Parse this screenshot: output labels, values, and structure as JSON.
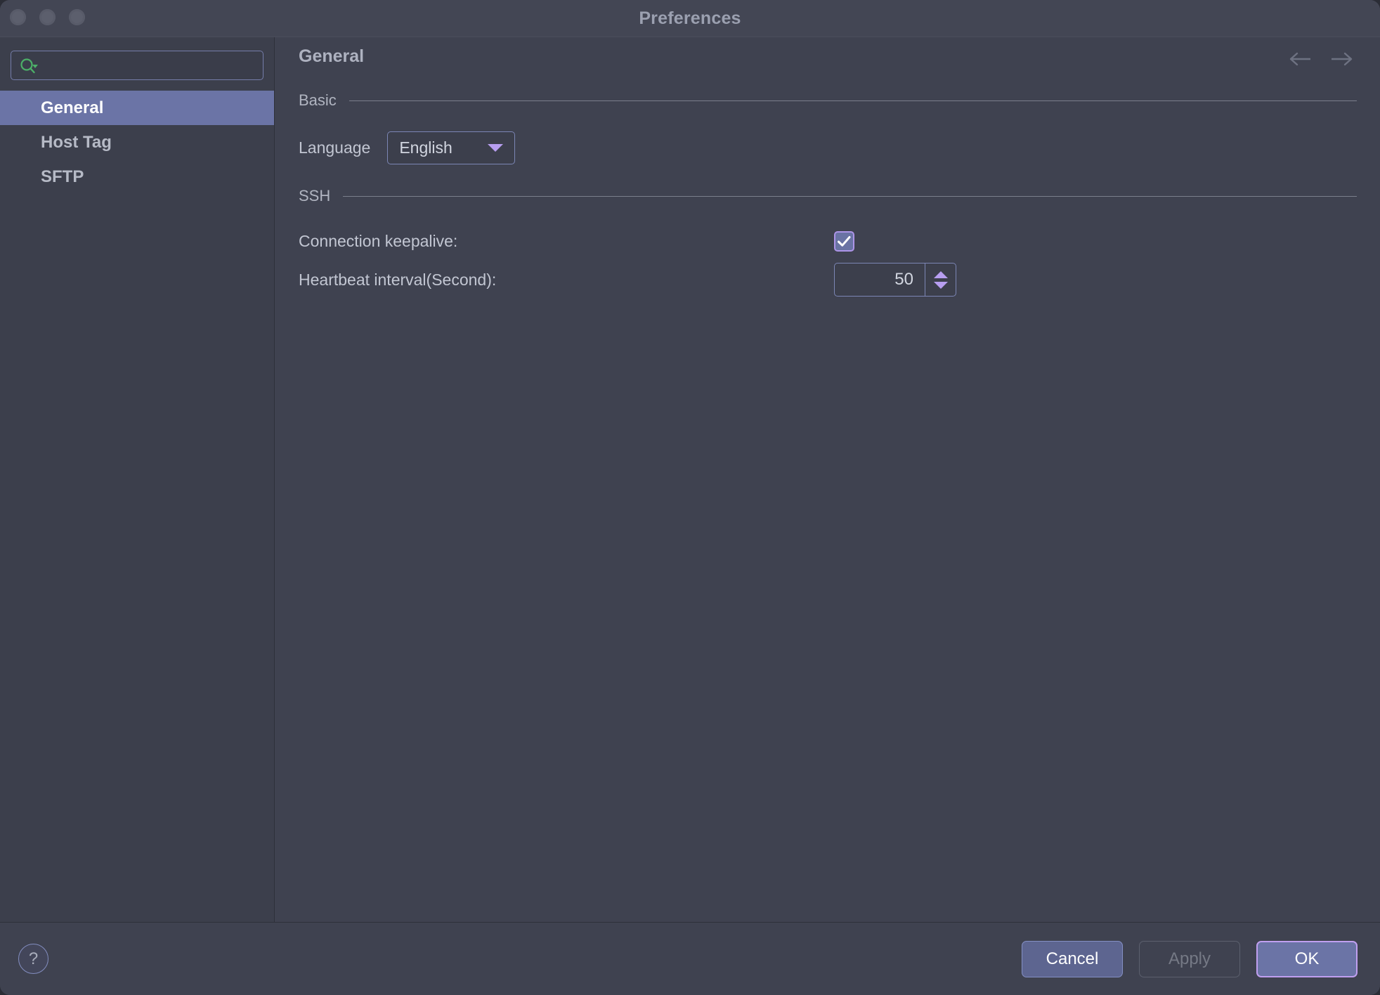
{
  "window": {
    "title": "Preferences",
    "traffic_lights": [
      "close-button",
      "minimize-button",
      "zoom-button"
    ]
  },
  "sidebar": {
    "search": {
      "placeholder": "",
      "value": "",
      "icon": "search-icon"
    },
    "items": [
      {
        "label": "General",
        "selected": true
      },
      {
        "label": "Host Tag",
        "selected": false
      },
      {
        "label": "SFTP",
        "selected": false
      }
    ]
  },
  "main": {
    "page_title": "General",
    "nav": {
      "back": "back-arrow-icon",
      "forward": "forward-arrow-icon"
    },
    "sections": [
      {
        "label": "Basic",
        "fields": [
          {
            "label": "Language",
            "type": "select",
            "value": "English",
            "options": [
              "English"
            ]
          }
        ]
      },
      {
        "label": "SSH",
        "fields": [
          {
            "label": "Connection keepalive:",
            "type": "checkbox",
            "checked": true
          },
          {
            "label": "Heartbeat interval(Second):",
            "type": "spinner",
            "value": "50"
          }
        ]
      }
    ]
  },
  "footer": {
    "help_label": "?",
    "buttons": [
      {
        "label": "Cancel",
        "state": "enabled"
      },
      {
        "label": "Apply",
        "state": "disabled"
      },
      {
        "label": "OK",
        "state": "default"
      }
    ]
  },
  "colors": {
    "window_bg": "#3f4250",
    "titlebar_bg": "#434654",
    "sidebar_bg": "#3c3f4c",
    "selection": "#6b74a6",
    "accent_purple": "#b79ef0",
    "border_blue": "#7c86b5",
    "search_icon_green": "#4caf68",
    "text_primary": "#c2c6d2",
    "text_muted": "#757985"
  }
}
